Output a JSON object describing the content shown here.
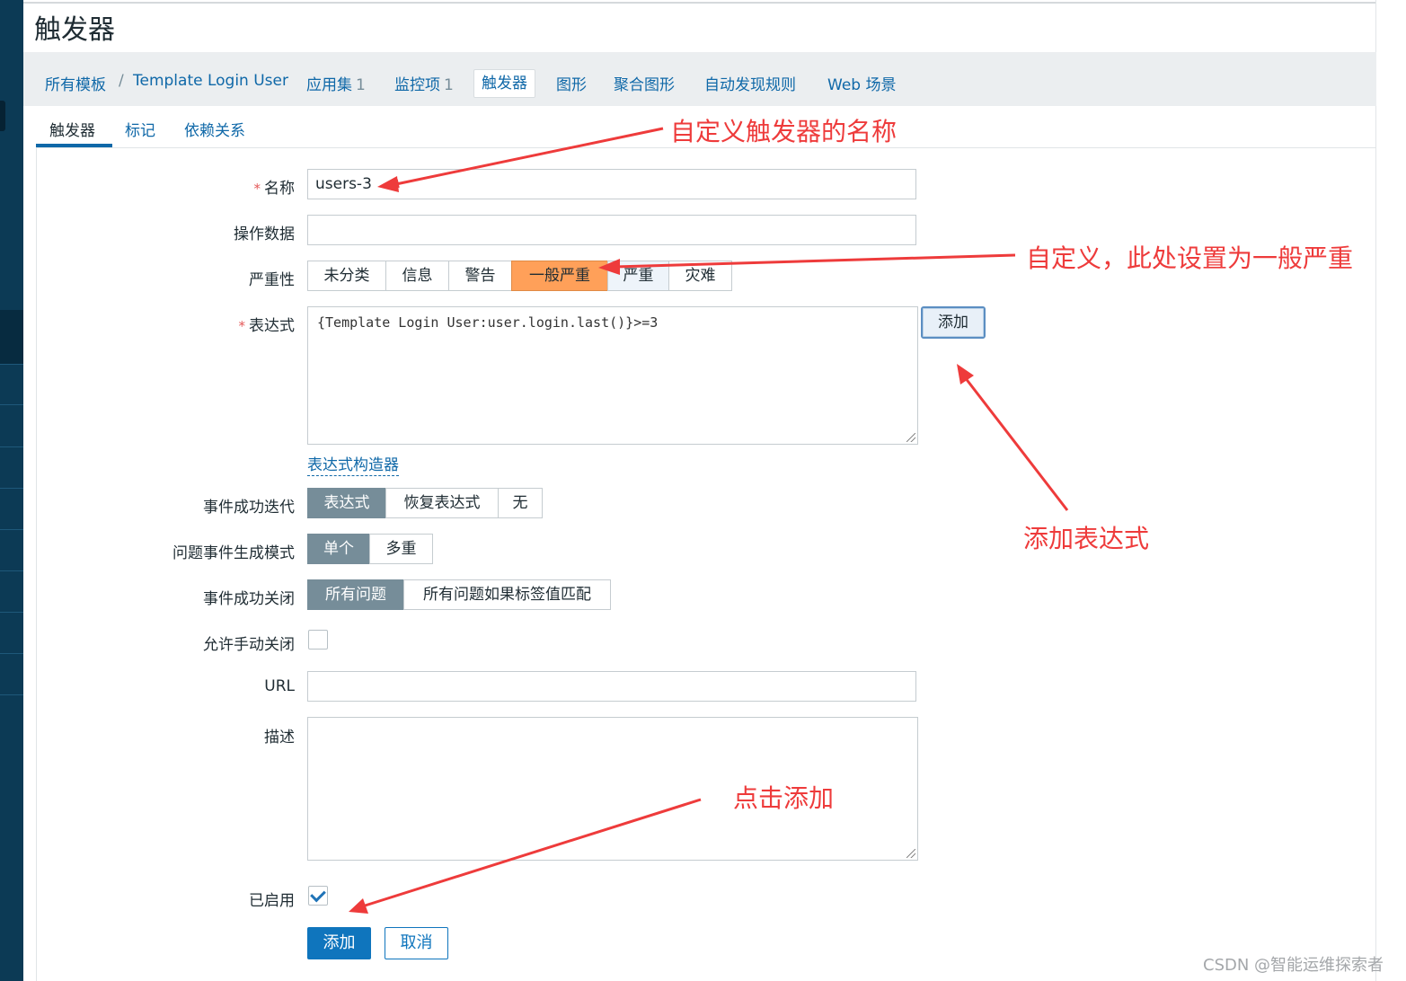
{
  "page_title": "触发器",
  "breadcrumb": {
    "all_templates": "所有模板",
    "separator": "/",
    "template": "Template Login User"
  },
  "nav": [
    {
      "label": "应用集",
      "count": "1"
    },
    {
      "label": "监控项",
      "count": "1"
    },
    {
      "label": "触发器",
      "count": ""
    },
    {
      "label": "图形",
      "count": ""
    },
    {
      "label": "聚合图形",
      "count": ""
    },
    {
      "label": "自动发现规则",
      "count": ""
    },
    {
      "label": "Web 场景",
      "count": ""
    }
  ],
  "tabs": [
    "触发器",
    "标记",
    "依赖关系"
  ],
  "form": {
    "name_label": "名称",
    "name_value": "users-3",
    "opdata_label": "操作数据",
    "opdata_value": "",
    "severity_label": "严重性",
    "severity_options": [
      "未分类",
      "信息",
      "警告",
      "一般严重",
      "严重",
      "灾难"
    ],
    "severity_selected": "一般严重",
    "expression_label": "表达式",
    "expression_value": "{Template Login User:user.login.last()}>=3",
    "add_expression_button": "添加",
    "expression_builder_link": "表达式构造器",
    "ok_event_label": "事件成功迭代",
    "ok_event_options": [
      "表达式",
      "恢复表达式",
      "无"
    ],
    "problem_mode_label": "问题事件生成模式",
    "problem_mode_options": [
      "单个",
      "多重"
    ],
    "ok_close_label": "事件成功关闭",
    "ok_close_options": [
      "所有问题",
      "所有问题如果标签值匹配"
    ],
    "manual_close_label": "允许手动关闭",
    "manual_close_checked": false,
    "url_label": "URL",
    "url_value": "",
    "description_label": "描述",
    "description_value": "",
    "enabled_label": "已启用",
    "enabled_checked": true,
    "submit_button": "添加",
    "cancel_button": "取消"
  },
  "annotations": {
    "name": "自定义触发器的名称",
    "severity": "自定义，此处设置为一般严重",
    "add_expression": "添加表达式",
    "click_add": "点击添加"
  },
  "watermark": "CSDN @智能运维探索者",
  "colors": {
    "accent": "#0f68a8",
    "severity_selected": "#ffa059",
    "toggle_selected": "#768d99",
    "annotation": "#ee3b3b"
  }
}
